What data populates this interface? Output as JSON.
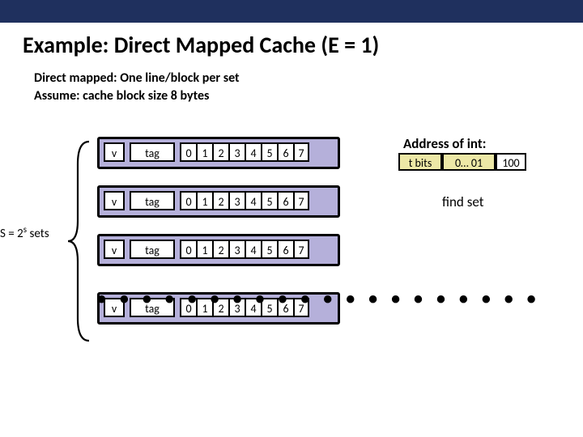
{
  "title": "Example: Direct Mapped Cache (E = 1)",
  "sub1": "Direct mapped: One line/block per set",
  "sub2": "Assume: cache block size 8 bytes",
  "sets_label_prefix": "S = 2",
  "sets_label_sup": "s",
  "sets_label_suffix": " sets",
  "row": {
    "v": "v",
    "tag": "tag",
    "bytes": [
      "0",
      "1",
      "2",
      "3",
      "4",
      "5",
      "6",
      "7"
    ]
  },
  "dots": "• • • • • • • • • • • • • • • • • • • •",
  "addr_title": "Address of int:",
  "addr_fields": {
    "tbits": "t bits",
    "set": "0… 01",
    "off": "100"
  },
  "findset": "find set"
}
